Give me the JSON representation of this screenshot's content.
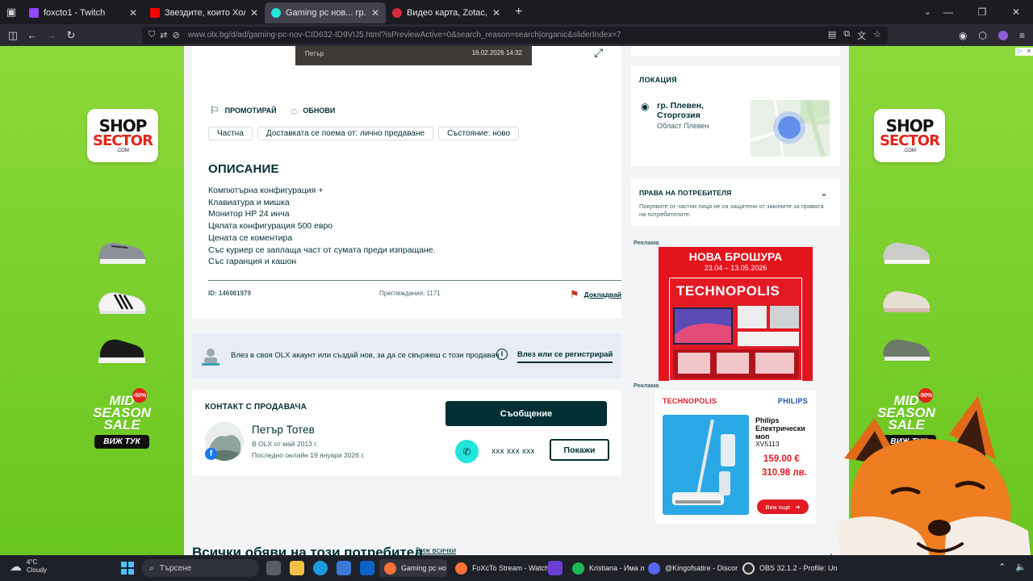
{
  "browser": {
    "tabs": [
      {
        "title": "foxcto1 - Twitch",
        "color": "#9146ff",
        "active": false
      },
      {
        "title": "Звездите, които Холивуд УНИЩ",
        "color": "#ff0000",
        "active": false
      },
      {
        "title": "Gaming pc нов... гр. Плевен Ст",
        "color": "#23e5db",
        "active": true
      },
      {
        "title": "Видео карта, Zotac, GeForce RT",
        "color": "#d62a3c",
        "active": false
      }
    ],
    "url": "www.olx.bg/d/ad/gaming-pc-nov-CID632-ID9VIJ5.html?isPreviewActive=0&search_reason=search|organic&sliderIndex=7"
  },
  "left_ad": {
    "logo_line1": "SHOP",
    "logo_line2": "SECTOR",
    "logo_line3": ".COM",
    "sale_line1": "MID",
    "sale_line2": "SEASON",
    "sale_line3": "SALE",
    "sale_badge": "-50%",
    "button": "ВИЖ ТУК"
  },
  "right_ad": {
    "logo_line1": "SHOP",
    "logo_line2": "SECTOR",
    "logo_line3": ".COM",
    "sale_line1": "MID",
    "sale_line2": "SEASON",
    "sale_line3": "SALE",
    "sale_badge": "-50%",
    "button": "ВИЖ ТУК"
  },
  "gallery": {
    "seller": "Петър",
    "date": "16.02.2026 14:32"
  },
  "ad": {
    "promote": "ПРОМОТИРАЙ",
    "refresh": "ОБНОВИ",
    "tags": [
      "Частна",
      "Доставката се поема от: лично предаване",
      "Състояние: ново"
    ],
    "description_title": "ОПИСАНИЕ",
    "description": [
      "Компютърна конфигурация +",
      "Клавиатура и мишка",
      "Монитор HP 24 инча",
      "Цялата конфигурация 500 евро",
      "Цената се коментира",
      "Със куриер се заплаща част от сумата преди изпращане.",
      "Със гаранция и кашон"
    ],
    "id": "ID: 146981979",
    "views": "Преглеждания: 1171",
    "report": "Докладвай"
  },
  "login": {
    "text": "Влез в своя OLX акаунт или създай нов, за да се свържеш с този продавач",
    "link": "Влез или се регистрирай"
  },
  "contact": {
    "title": "КОНТАКТ С ПРОДАВАЧА",
    "name": "Петър Тотев",
    "since": "В OLX от май 2013 г.",
    "online": "Последно онлайн 19 януари 2026 г.",
    "message_button": "Съобщение",
    "phone": "xxx xxx xxx",
    "show_button": "Покажи"
  },
  "more": {
    "title": "Всички обяви на този потребител",
    "link": "Виж всички"
  },
  "location": {
    "title": "ЛОКАЦИЯ",
    "city": "гр. Плевен, Сторгозия",
    "region": "Област Плевен"
  },
  "consumer": {
    "title": "ПРАВА НА ПОТРЕБИТЕЛЯ",
    "text": "Покупките от частни лица не са защитени от законите за правата на потребителите."
  },
  "sidebar_ads": {
    "label": "Реклама",
    "brochure_title": "НОВА БРОШУРА",
    "brochure_dates": "23.04 – 13.05.2026",
    "brochure_brand": "TECHNOPOLIS",
    "mop_brand_left": "TECHNOPOLIS",
    "mop_brand_right": "PHILIPS",
    "mop_name": "Philips Електрически моп",
    "mop_model": "XV5113",
    "price_eur": "159.00 €",
    "price_bgn": "310.98 лв.",
    "more": "Виж още"
  },
  "taskbar": {
    "temp": "4°C",
    "weather": "Cloudy",
    "search": "Търсене",
    "apps": [
      {
        "label": "Gaming pc но",
        "color": "#ff7139"
      },
      {
        "label": "FoXcTo Stream - Watch",
        "color": "#ff7139"
      },
      {
        "label": "Kristiana - Има л",
        "color": "#1db954"
      },
      {
        "label": "@Kingofsatire - Discor",
        "color": "#5865f2"
      },
      {
        "label": "OBS 32.1.2 - Profile: Un",
        "color": "#2b2b2b"
      }
    ]
  }
}
